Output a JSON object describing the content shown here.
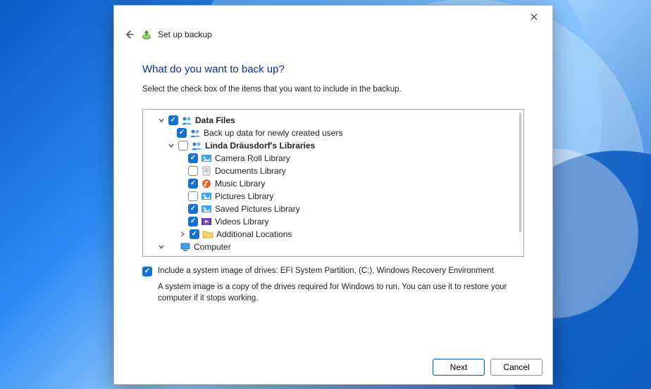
{
  "window": {
    "title": "Set up backup"
  },
  "page": {
    "heading": "What do you want to back up?",
    "subtext": "Select the check box of the items that you want to include in the backup."
  },
  "tree": {
    "data_files": {
      "label": "Data Files",
      "checked": true,
      "expanded": true
    },
    "new_users": {
      "label": "Back up data for newly created users",
      "checked": true
    },
    "user_libs": {
      "label": "Linda Dräusdorf's Libraries",
      "checked": false,
      "expanded": true
    },
    "camera_roll": {
      "label": "Camera Roll Library",
      "checked": true
    },
    "documents": {
      "label": "Documents Library",
      "checked": false
    },
    "music": {
      "label": "Music Library",
      "checked": true
    },
    "pictures": {
      "label": "Pictures Library",
      "checked": false
    },
    "saved_pictures": {
      "label": "Saved Pictures Library",
      "checked": true
    },
    "videos": {
      "label": "Videos Library",
      "checked": true
    },
    "additional": {
      "label": "Additional Locations",
      "checked": true,
      "expanded": false
    },
    "computer": {
      "label": "Computer",
      "checked": false,
      "expanded": true
    }
  },
  "sysimg": {
    "checked": true,
    "label": "Include a system image of drives: EFI System Partition, (C:), Windows Recovery Environment",
    "desc": "A system image is a copy of the drives required for Windows to run. You can use it to restore your computer if it stops working."
  },
  "buttons": {
    "next": "Next",
    "cancel": "Cancel"
  }
}
